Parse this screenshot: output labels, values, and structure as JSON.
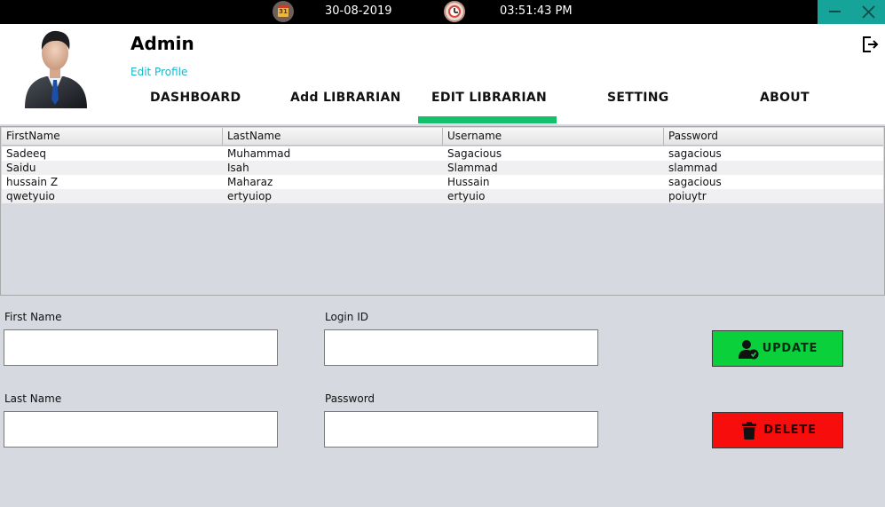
{
  "topbar": {
    "calendar_day": "31",
    "date": "30-08-2019",
    "time": "03:51:43 PM",
    "icons": {
      "calendar": "calendar-icon",
      "clock": "clock-icon",
      "minimize": "minimize-icon",
      "close": "close-icon"
    }
  },
  "header": {
    "user_name": "Admin",
    "edit_profile": "Edit Profile",
    "logout_icon": "logout-icon"
  },
  "nav": {
    "items": [
      {
        "label": "DASHBOARD"
      },
      {
        "label": "Add LIBRARIAN"
      },
      {
        "label": "EDIT LIBRARIAN",
        "active": true
      },
      {
        "label": "SETTING"
      },
      {
        "label": "ABOUT"
      }
    ],
    "active_color": "#14c16a"
  },
  "table": {
    "columns": [
      "FirstName",
      "LastName",
      "Username",
      "Password"
    ],
    "rows": [
      [
        "Sadeeq",
        "Muhammad",
        "Sagacious",
        "sagacious"
      ],
      [
        "Saidu",
        "Isah",
        "Slammad",
        "slammad"
      ],
      [
        "hussain Z",
        "Maharaz",
        "Hussain",
        "sagacious"
      ],
      [
        "qwetyuio",
        "ertyuiop",
        "ertyuio",
        "poiuytr"
      ]
    ]
  },
  "form": {
    "first_name_label": "First Name",
    "last_name_label": "Last Name",
    "login_id_label": "Login ID",
    "password_label": "Password",
    "first_name_value": "",
    "last_name_value": "",
    "login_id_value": "",
    "password_value": ""
  },
  "buttons": {
    "update": "UPDATE",
    "delete": "DELETE",
    "update_color": "#0ad03b",
    "delete_color": "#f80d0d"
  }
}
